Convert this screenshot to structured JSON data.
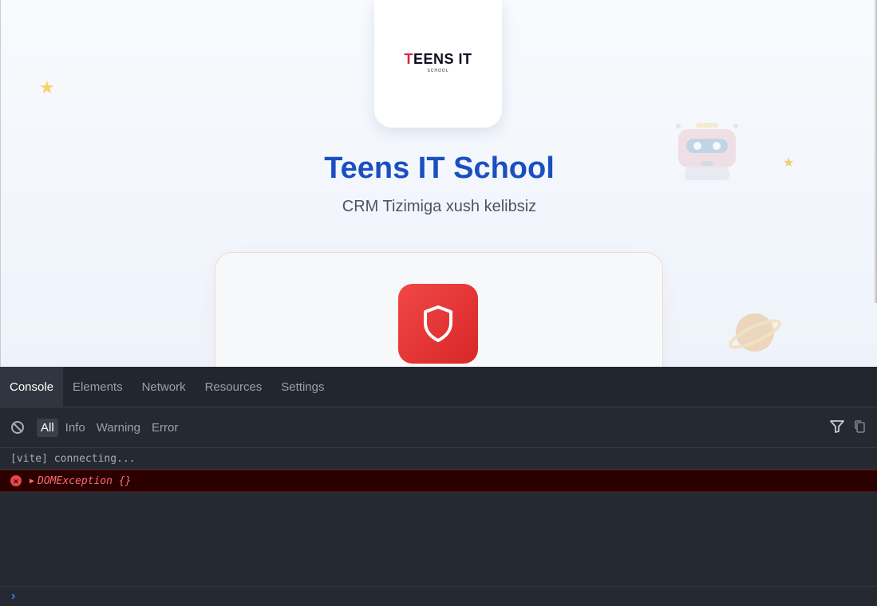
{
  "page": {
    "logo": {
      "word": "EENS IT",
      "accent_letter": "T",
      "sub": "SCHOOL"
    },
    "title": "Teens IT School",
    "subtitle": "CRM Tizimiga xush kelibsiz"
  },
  "devtools": {
    "tabs": [
      {
        "label": "Console",
        "active": true
      },
      {
        "label": "Elements",
        "active": false
      },
      {
        "label": "Network",
        "active": false
      },
      {
        "label": "Resources",
        "active": false
      },
      {
        "label": "Settings",
        "active": false
      }
    ],
    "levels": [
      {
        "label": "All",
        "active": true
      },
      {
        "label": "Info",
        "active": false
      },
      {
        "label": "Warning",
        "active": false
      },
      {
        "label": "Error",
        "active": false
      }
    ],
    "logs": [
      {
        "type": "log",
        "text": "[vite] connecting..."
      },
      {
        "type": "error",
        "text": "DOMException {}"
      }
    ]
  },
  "colors": {
    "brand_blue": "#1a4fc2",
    "shield_red": "#e33535",
    "devtools_bg": "#252932",
    "error_text": "#ff6a6a"
  },
  "icons": [
    "star-icon",
    "robot-icon",
    "planet-icon",
    "shield-icon",
    "clear-console-icon",
    "filter-icon",
    "copy-icon",
    "error-icon",
    "expand-arrow-icon",
    "prompt-chevron-icon"
  ]
}
